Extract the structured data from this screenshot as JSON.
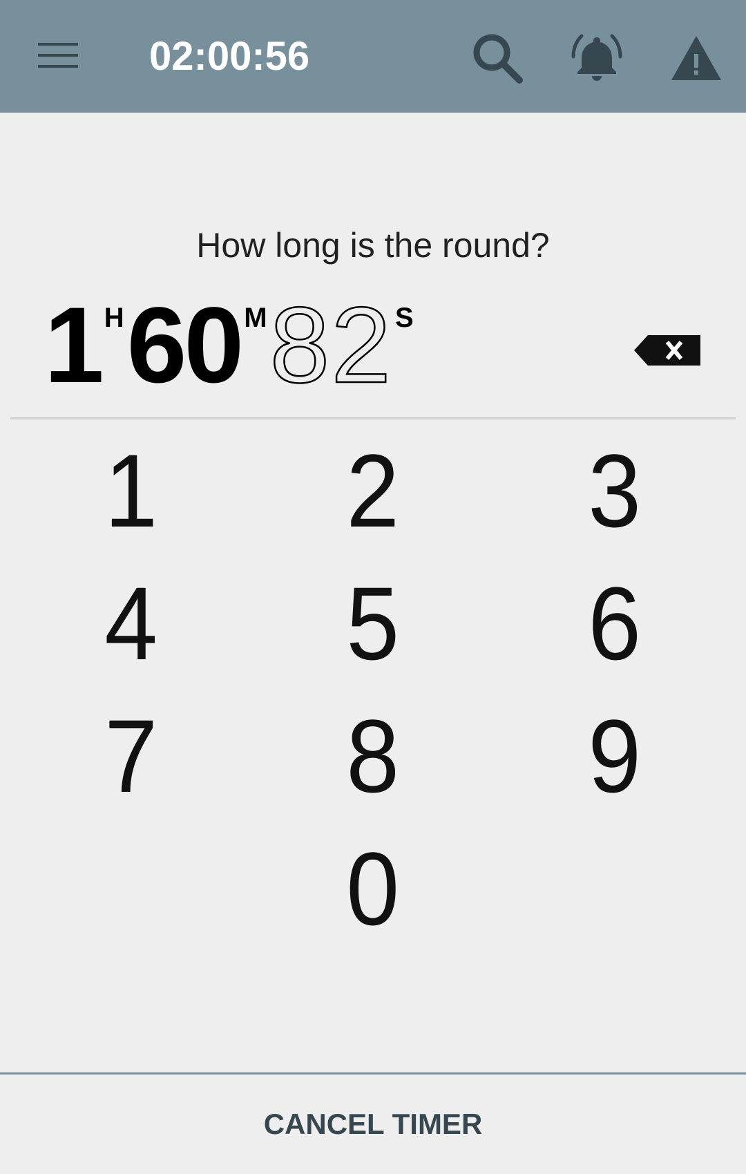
{
  "appbar": {
    "clock": "02:00:56",
    "icons": [
      "menu-icon",
      "search-icon",
      "bell-ringing-icon",
      "warning-icon"
    ],
    "color": "#78909c"
  },
  "prompt": "How long is the round?",
  "entry": {
    "hours": "1",
    "hours_unit": "H",
    "minutes": "60",
    "minutes_unit": "M",
    "seconds": "82",
    "seconds_unit": "S"
  },
  "keypad": {
    "keys": [
      "1",
      "2",
      "3",
      "4",
      "5",
      "6",
      "7",
      "8",
      "9",
      "0"
    ]
  },
  "footer": {
    "cancel_label": "CANCEL TIMER"
  }
}
